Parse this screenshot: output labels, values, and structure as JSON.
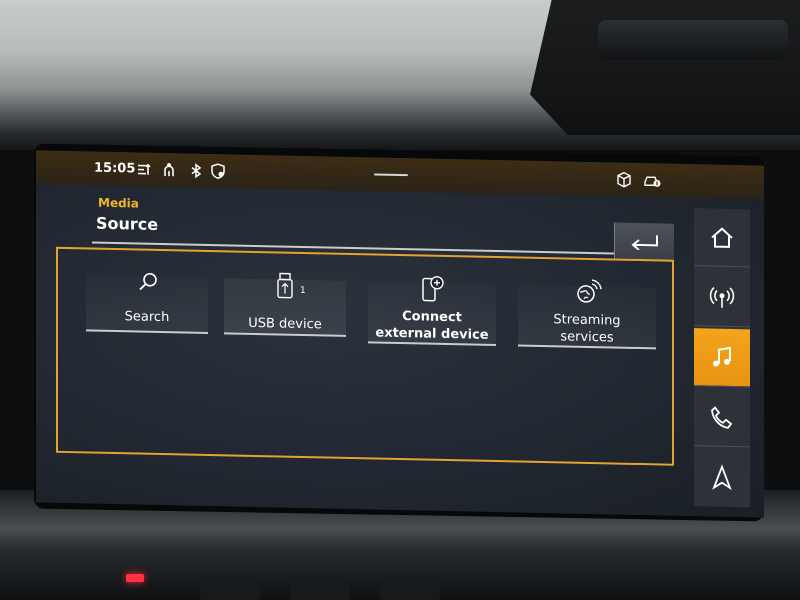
{
  "status": {
    "time": "15:05",
    "icons": [
      "traffic-sign-icon",
      "driver-profile-icon",
      "bluetooth-icon",
      "shield-icon",
      "package-icon",
      "connected-car-icon"
    ]
  },
  "header": {
    "breadcrumb": "Media",
    "title": "Source",
    "back_icon": "back-arrow-icon"
  },
  "sources": [
    {
      "label": "Search",
      "icon": "search-icon"
    },
    {
      "label": "USB device",
      "icon": "usb-icon",
      "badge": "1"
    },
    {
      "label_line1": "Connect",
      "label_line2": "external device",
      "icon": "phone-add-icon"
    },
    {
      "label_line1": "Streaming",
      "label_line2": "services",
      "icon": "streaming-globe-icon"
    }
  ],
  "side_nav": [
    {
      "icon": "home-icon",
      "active": false
    },
    {
      "icon": "radio-icon",
      "active": false
    },
    {
      "icon": "music-note-icon",
      "active": true
    },
    {
      "icon": "phone-icon",
      "active": false
    },
    {
      "icon": "navigation-icon",
      "active": false
    }
  ],
  "colors": {
    "accent": "#f2a21c",
    "frame": "#e3a233",
    "breadcrumb": "#f2b62a"
  }
}
